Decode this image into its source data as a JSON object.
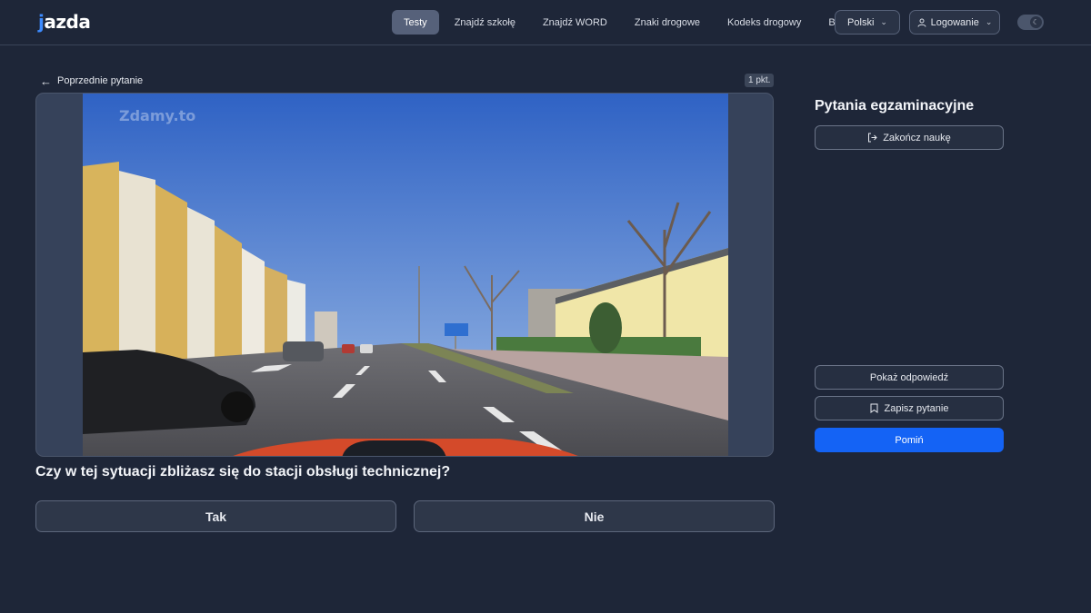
{
  "header": {
    "logo": "jazda",
    "nav": [
      "Testy",
      "Znajdź szkołę",
      "Znajdź WORD",
      "Znaki drogowe",
      "Kodeks drogowy",
      "Blog"
    ],
    "active_nav": "Testy",
    "language": "Polski",
    "login": "Logowanie"
  },
  "question": {
    "prev_label": "Poprzednie pytanie",
    "points": "1 pkt.",
    "text": "Czy w tej sytuacji zbliżasz się do stacji obsługi technicznej?",
    "answers": [
      "Tak",
      "Nie"
    ],
    "media_watermark": "Zdamy.to"
  },
  "sidebar": {
    "title": "Pytania egzaminacyjne",
    "end_label": "Zakończ naukę",
    "show_label": "Pokaż odpowiedź",
    "save_label": "Zapisz pytanie",
    "skip_label": "Pomiń"
  },
  "colors": {
    "background": "#1e2638",
    "accent": "#1463f5",
    "logo_accent": "#3d8bff"
  }
}
